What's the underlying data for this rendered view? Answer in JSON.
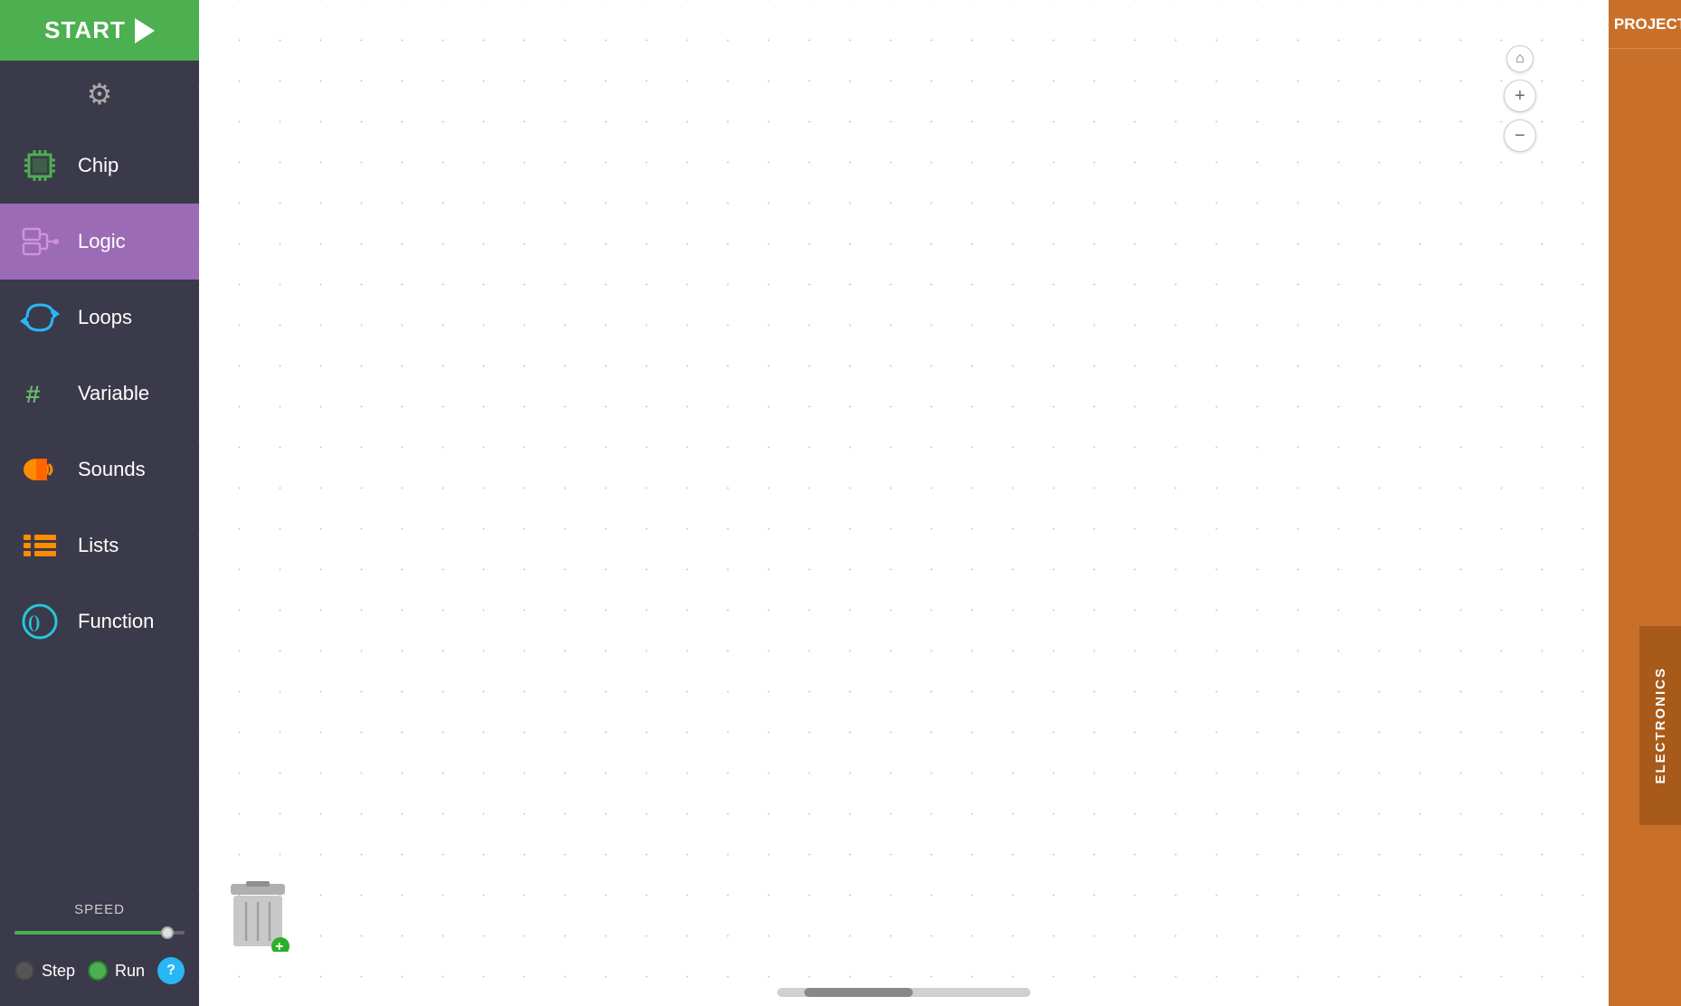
{
  "sidebar": {
    "start_label": "START",
    "items": [
      {
        "id": "chip",
        "label": "Chip",
        "icon": "chip-icon",
        "active": false
      },
      {
        "id": "logic",
        "label": "Logic",
        "icon": "logic-icon",
        "active": true
      },
      {
        "id": "loops",
        "label": "Loops",
        "icon": "loops-icon",
        "active": false
      },
      {
        "id": "variable",
        "label": "Variable",
        "icon": "variable-icon",
        "active": false
      },
      {
        "id": "sounds",
        "label": "Sounds",
        "icon": "sounds-icon",
        "active": false
      },
      {
        "id": "lists",
        "label": "Lists",
        "icon": "lists-icon",
        "active": false
      },
      {
        "id": "function",
        "label": "Function",
        "icon": "function-icon",
        "active": false
      }
    ],
    "speed_label": "SPEED",
    "step_label": "Step",
    "run_label": "Run",
    "help_label": "?"
  },
  "right_panel": {
    "projects_label": "PROJECTS",
    "electronics_label": "ELECTRONICS"
  },
  "zoom": {
    "home": "⌂",
    "plus": "+",
    "minus": "−"
  }
}
